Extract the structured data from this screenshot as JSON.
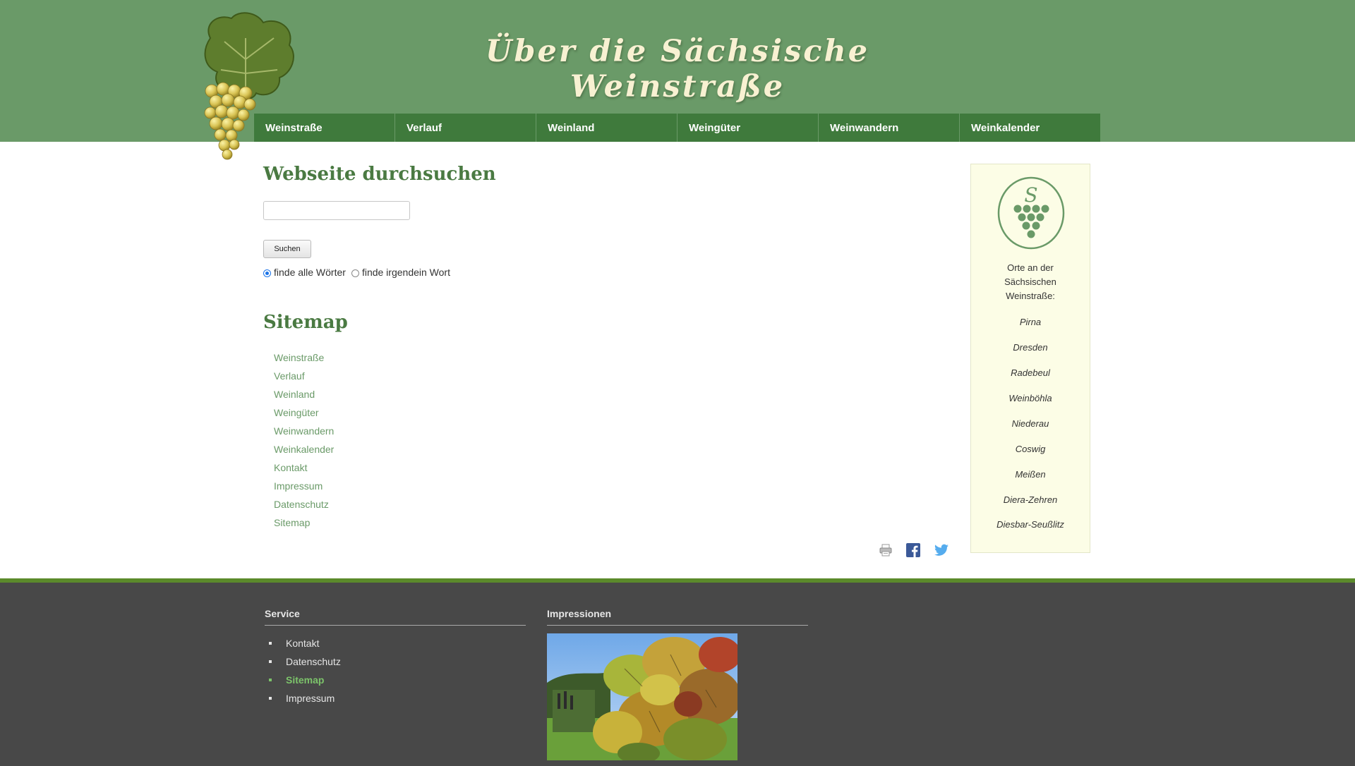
{
  "header": {
    "site_title": "Über die Sächsische Weinstraße"
  },
  "nav": {
    "items": [
      "Weinstraße",
      "Verlauf",
      "Weinland",
      "Weingüter",
      "Weinwandern",
      "Weinkalender"
    ]
  },
  "search": {
    "heading": "Webseite durchsuchen",
    "input_value": "",
    "button_label": "Suchen",
    "option_all": "finde alle Wörter",
    "option_any": "finde irgendein Wort",
    "selected_option": "finde alle Wörter"
  },
  "sitemap": {
    "heading": "Sitemap",
    "links": [
      "Weinstraße",
      "Verlauf",
      "Weinland",
      "Weingüter",
      "Weinwandern",
      "Weinkalender",
      "Kontakt",
      "Impressum",
      "Datenschutz",
      "Sitemap"
    ]
  },
  "share": {
    "icons": [
      "print-icon",
      "facebook-icon",
      "twitter-icon"
    ]
  },
  "sidebar": {
    "logo_letter": "S",
    "heading_lines": [
      "Orte an der",
      "Sächsischen",
      "Weinstraße:"
    ],
    "places": [
      "Pirna",
      "Dresden",
      "Radebeul",
      "Weinböhla",
      "Niederau",
      "Coswig",
      "Meißen",
      "Diera-Zehren",
      "Diesbar-Seußlitz"
    ]
  },
  "footer": {
    "service_title": "Service",
    "service_links": [
      "Kontakt",
      "Datenschutz",
      "Sitemap",
      "Impressum"
    ],
    "active_link": "Sitemap",
    "impressions_title": "Impressionen"
  },
  "colors": {
    "header_bg": "#6a9a68",
    "nav_bg": "#3f7a3c",
    "heading_green": "#4a7a42",
    "link_green": "#6a9a68",
    "sidebar_bg": "#fcfde6",
    "footer_bg": "#484848",
    "footer_accent": "#5b8a2b",
    "footer_active": "#7cc36a"
  }
}
